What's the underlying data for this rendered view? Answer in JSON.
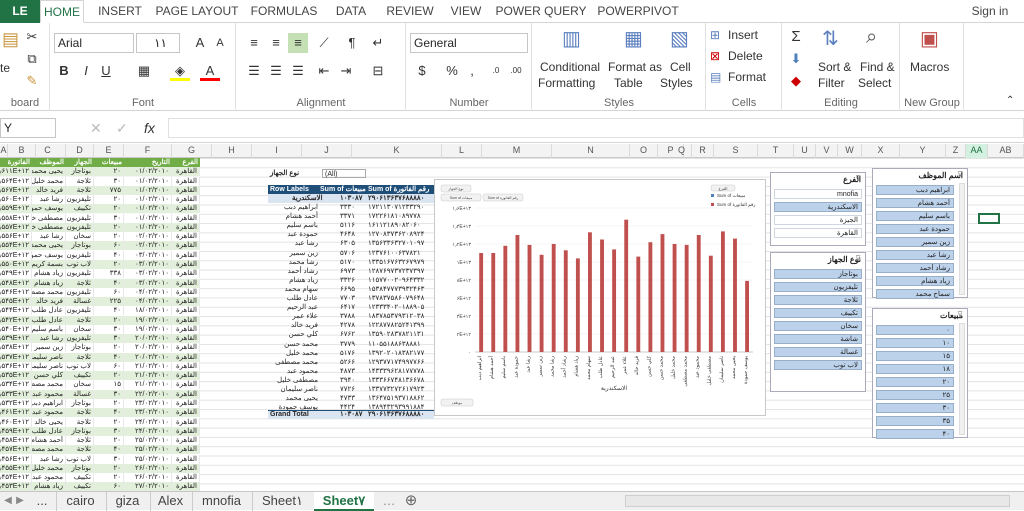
{
  "tabs": {
    "file": "LE",
    "items": [
      "HOME",
      "INSERT",
      "PAGE LAYOUT",
      "FORMULAS",
      "DATA",
      "REVIEW",
      "VIEW",
      "POWER QUERY",
      "POWERPIVOT"
    ],
    "signin": "Sign in"
  },
  "ribbon": {
    "clipboard": {
      "paste": "te",
      "label": "board"
    },
    "font": {
      "name": "Arial",
      "size": "۱۱",
      "grow": "A",
      "shrink": "A",
      "bold": "B",
      "italic": "I",
      "underline": "U",
      "label": "Font"
    },
    "alignment": {
      "label": "Alignment"
    },
    "number": {
      "format": "General",
      "pct": "%",
      "comma": ",",
      "label": "Number"
    },
    "styles": {
      "cond1": "Conditional",
      "cond2": "Formatting",
      "table1": "Format as",
      "table2": "Table",
      "cell1": "Cell",
      "cell2": "Styles",
      "label": "Styles"
    },
    "cells": {
      "insert": "Insert",
      "delete": "Delete",
      "format": "Format",
      "label": "Cells"
    },
    "editing": {
      "sort1": "Sort &",
      "sort2": "Filter",
      "find1": "Find &",
      "find2": "Select",
      "label": "Editing"
    },
    "newgroup": {
      "macros": "Macros",
      "label": "New Group"
    }
  },
  "namebox": "Y",
  "columns": [
    "A",
    "B",
    "C",
    "D",
    "E",
    "F",
    "G",
    "H",
    "I",
    "J",
    "K",
    "L",
    "M",
    "N",
    "O",
    "P",
    "Q",
    "R",
    "S",
    "T",
    "U",
    "V",
    "W",
    "X",
    "Y",
    "Z",
    "AA",
    "AB"
  ],
  "table": {
    "headers": [
      "الفاتورة",
      "الموظف",
      "الجهاز",
      "مبيعات",
      "التاريخ",
      "الفرع"
    ],
    "rows": [
      [
        "۲٫۶۱۱E+۱۲",
        "يحيى محمد",
        "بوتاجاز",
        "۲۰",
        "۰۱/۰۲/۲۰۱۰",
        "القاهرة"
      ],
      [
        "۲٫۵۶۴E+۱۲",
        "محمد خليل",
        "ثلاجة",
        "۳۰",
        "۰۱/۰۲/۲۰۱۰",
        "القاهرة"
      ],
      [
        "۲٫۵۶۷E+۱۲",
        "فريد خالد",
        "ثلاجة",
        "۷۷۵",
        "۰۱/۰۲/۲۰۱۰",
        "القاهرة"
      ],
      [
        "۲٫۵۶۰E+۱۲",
        "رشا عبد",
        "تليفزيون",
        "۲۰",
        "۰۱/۰۲/۲۰۱۰",
        "القاهرة"
      ],
      [
        "۲٫۵۵۹E+۱۲",
        "يوسف حمودة",
        "تكييف",
        "۲۰",
        "۰۱/۰۲/۲۰۱۰",
        "القاهرة"
      ],
      [
        "۲٫۵۵۸E+۱۲",
        "مصطفى خليل",
        "تليفزيون",
        "۳۰",
        "۰۱/۰۲/۲۰۱۰",
        "القاهرة"
      ],
      [
        "۲٫۵۵۷E+۱۲",
        "مصطفى خليل",
        "تليفزيون",
        "۲۰",
        "۰۱/۰۲/۲۰۱۰",
        "القاهرة"
      ],
      [
        "۲٫۵۵۶E+۱۲",
        "رشا عبد",
        "سخان",
        "۲۰",
        "۰۲/۰۲/۲۰۱۰",
        "القاهرة"
      ],
      [
        "۲٫۵۵۴E+۱۲",
        "يحيى محمد",
        "بوتاجاز",
        "۶۰",
        "۰۲/۰۲/۲۰۱۰",
        "القاهرة"
      ],
      [
        "۲٫۵۵۲E+۱۲",
        "يوسف حمودة",
        "تليفزيون",
        "۴۰",
        "۰۳/۰۲/۲۰۱۰",
        "القاهرة"
      ],
      [
        "۲٫۵۵۰E+۱۲",
        "بسمة كريم",
        "لاب توب",
        "۲۰",
        "۰۳/۰۲/۲۰۱۰",
        "القاهرة"
      ],
      [
        "۲٫۵۴۹E+۱۲",
        "زياد هشام",
        "تليفزيون",
        "۳۳۸",
        "۰۳/۰۲/۲۰۱۰",
        "القاهرة"
      ],
      [
        "۲٫۵۴۸E+۱۲",
        "زياد هشام",
        "ثلاجة",
        "۴۰",
        "۰۳/۰۲/۲۰۱۰",
        "القاهرة"
      ],
      [
        "۲٫۵۴۶E+۱۲",
        "محمد مصطفى",
        "تليفزيون",
        "۶۰",
        "۰۴/۰۲/۲۰۱۰",
        "القاهرة"
      ],
      [
        "۲٫۵۴۵E+۱۲",
        "فريد خالد",
        "غسالة",
        "۲۲۵",
        "۰۴/۰۲/۲۰۱۰",
        "القاهرة"
      ],
      [
        "۲٫۵۴۴E+۱۲",
        "عادل طلب",
        "تليفزيون",
        "۴۰",
        "۱۸/۰۲/۲۰۱۰",
        "القاهرة"
      ],
      [
        "۲٫۵۴۲E+۱۲",
        "عادل طلب",
        "ثلاجة",
        "۲۰",
        "۱۹/۰۲/۲۰۱۰",
        "القاهرة"
      ],
      [
        "۲٫۵۴۰E+۱۲",
        "باسم سليم",
        "سخان",
        "۳۰",
        "۱۹/۰۲/۲۰۱۰",
        "القاهرة"
      ],
      [
        "۲٫۵۳۹E+۱۲",
        "رشا عبد",
        "تليفزيون",
        "۳۰",
        "۲۰/۰۲/۲۰۱۰",
        "القاهرة"
      ],
      [
        "۲٫۵۳۸E+۱۲",
        "زين سمير",
        "بوتاجاز",
        "۲۰",
        "۲۰/۰۲/۲۰۱۰",
        "القاهرة"
      ],
      [
        "۲٫۵۳۷E+۱۲",
        "ناصر سليمان",
        "ثلاجة",
        "۴۰",
        "۲۰/۰۲/۲۰۱۰",
        "القاهرة"
      ],
      [
        "۲٫۵۳۶E+۱۲",
        "ناصر سليمان",
        "لاب توب",
        "۶۰",
        "۲۱/۰۲/۲۰۱۰",
        "القاهرة"
      ],
      [
        "۲٫۵۳۵E+۱۲",
        "كلي حسن",
        "تكييف",
        "۲۰",
        "۲۱/۰۲/۲۰۱۰",
        "القاهرة"
      ],
      [
        "۲٫۵۳۴E+۱۲",
        "محمد مصطفى",
        "سخان",
        "۱۵",
        "۲۱/۰۲/۲۰۱۰",
        "القاهرة"
      ],
      [
        "۲٫۵۳۳E+۱۲",
        "محمود عبد",
        "غسالة",
        "۳۰",
        "۲۲/۰۲/۲۰۱۰",
        "القاهرة"
      ],
      [
        "۲٫۵۳۲E+۱۲",
        "ابراهيم دبب",
        "بوتاجاز",
        "۲۰",
        "۲۳/۰۲/۲۰۱۰",
        "القاهرة"
      ],
      [
        "۲٫۴۶۱E+۱۲",
        "محمود عبد",
        "ثلاجة",
        "۴۰",
        "۲۳/۰۲/۲۰۱۰",
        "القاهرة"
      ],
      [
        "۲٫۴۶۰E+۱۲",
        "يحيى خالد",
        "ثلاجة",
        "۲۰",
        "۲۴/۰۲/۲۰۱۰",
        "القاهرة"
      ],
      [
        "۲٫۴۵۹E+۱۲",
        "عادل طلب",
        "بوتاجاز",
        "۳۰",
        "۲۴/۰۲/۲۰۱۰",
        "القاهرة"
      ],
      [
        "۲٫۴۵۸E+۱۲",
        "أحمد هشام",
        "ثلاجة",
        "۲۰",
        "۲۵/۰۲/۲۰۱۰",
        "القاهرة"
      ],
      [
        "۲٫۴۵۷E+۱۲",
        "محمد مصطفى",
        "ثلاجة",
        "۴۰",
        "۲۵/۰۲/۲۰۱۰",
        "القاهرة"
      ],
      [
        "۲٫۴۵۶E+۱۲",
        "رشا عبد",
        "لاب توب",
        "۳۰",
        "۲۵/۰۲/۲۰۱۰",
        "القاهرة"
      ],
      [
        "۲٫۴۵۵E+۱۲",
        "محمد خليل",
        "بوتاجاز",
        "۲۰",
        "۲۶/۰۲/۲۰۱۰",
        "القاهرة"
      ],
      [
        "۲٫۴۵۴E+۱۲",
        "محمود عبد",
        "تكييف",
        "۲۰",
        "۲۶/۰۲/۲۰۱۰",
        "القاهرة"
      ],
      [
        "۲٫۴۵۳E+۱۲",
        "زياد هشام",
        "تكييف",
        "۶۰",
        "۲۷/۰۲/۲۰۱۰",
        "القاهرة"
      ]
    ]
  },
  "pivot": {
    "filter_label": "نوع الجهاز",
    "filter_value": "(All)",
    "headers": [
      "Row Labels",
      "Sum of مبيعات",
      "Sum of رقم الفاتورة"
    ],
    "group": "الاسكندرية",
    "group_vals": [
      "۱۰۳۰۸۷",
      "۲۹۰۶۱۳۶۳۷۶۸۸۸۸۰"
    ],
    "rows": [
      [
        "ابراهيم دبب",
        "۳۳۳۰",
        "۱۷۲۱۱۳۰۷۱۲۳۳۲۹۰"
      ],
      [
        "أحمد هشام",
        "۳۳۷۱",
        "۱۷۲۲۶۱۸۱۰۸۹۷۷۸"
      ],
      [
        "باسم سليم",
        "۵۱۱۶",
        "۱۶۱۱۲۱۸۹۰۸۲۰۶۰"
      ],
      [
        "حمودة عبد",
        "۴۶۴۸",
        "۱۲۷۰۸۳۷۳۶۲۰۸۹۲۴"
      ],
      [
        "رشا عبد",
        "۶۳۰۵",
        "۱۳۵۶۳۳۶۳۲۷۰۱۰۹۷"
      ],
      [
        "زين سمير",
        "۵۷۰۶",
        "۱۲۳۷۶۱۰۰۶۳۷۸۲۱"
      ],
      [
        "رشا محمد",
        "۵۱۷۰",
        "۱۳۳۵۱۶۷۶۳۲۶۷۹۷۹"
      ],
      [
        "رشاد أحمد",
        "۶۹۷۳",
        "۱۲۸۷۶۹۷۳۷۲۳۷۳۹۷"
      ],
      [
        "زياد هشام",
        "۳۳۲۶",
        "۱۱۵۷۷۰۰۲۰۹۶۴۳۳۲"
      ],
      [
        "سهام محمد",
        "۶۶۹۵",
        "۱۵۳۸۴۷۷۷۳۹۳۲۴۶۳"
      ],
      [
        "عادل طلب",
        "۷۷۰۳",
        "۱۳۷۸۳۷۵۸۶۰۷۹۶۴۸"
      ],
      [
        "عبد الرحيم",
        "۶۴۱۷",
        "۱۲۳۳۳۴۰۲۰۱۸۸۹۰۵"
      ],
      [
        "علاء عمر",
        "۳۷۸۸",
        "۱۸۳۷۸۵۳۷۹۳۱۲۰۳۸"
      ],
      [
        "فريد خالد",
        "۴۲۷۸",
        "۱۲۲۸۷۷۸۲۵۲۴۱۳۹۹"
      ],
      [
        "كلي حسن",
        "۶۷۶۲",
        "۱۳۵۹۰۲۸۳۷۸۲۱۱۳۱"
      ],
      [
        "محمد حسن",
        "۳۷۷۹",
        "۱۱۰۵۵۱۸۸۶۳۸۸۸۱"
      ],
      [
        "محمد خليل",
        "۵۱۷۶",
        "۱۳۹۲۰۲۰۱۸۳۸۲۱۷۷"
      ],
      [
        "محمد مصطفى",
        "۵۲۶۶",
        "۱۲۹۳۷۷۱۷۴۹۹۷۷۶۶"
      ],
      [
        "محمود عبد",
        "۴۸۷۳",
        "۱۴۳۳۳۹۶۲۸۱۷۷۷۷۸"
      ],
      [
        "مصطفى خليل",
        "۳۹۴۰",
        "۱۳۳۳۶۶۷۴۸۱۳۶۶۷۸"
      ],
      [
        "ناصر سليمان",
        "۷۷۲۶",
        "۱۳۳۷۷۳۲۷۲۶۱۷۹۲۳"
      ],
      [
        "يحيى محمد",
        "۴۷۳۳",
        "۱۳۶۴۷۵۱۹۳۷۱۸۸۶۲"
      ],
      [
        "يوسف حمودة",
        "۴۴۲۴",
        "۱۳۸۹۴۳۲۹۳۹۹۱۸۸۴"
      ]
    ],
    "total": "Grand Total",
    "total_vals": [
      "۱۰۳۰۸۷",
      "۲۹۰۶۱۳۶۳۷۶۸۸۸۸۰"
    ]
  },
  "chart_data": {
    "type": "bar",
    "categories": [
      "ابراهيم دبب",
      "أحمد هشام",
      "باسم سليم",
      "حمودة عبد",
      "رشا عبد",
      "زين سمير",
      "رشا محمد",
      "رشاد أحمد",
      "زياد هشام",
      "سهام محمد",
      "عادل طلب",
      "عبد الرحيم",
      "علاء عمر",
      "فريد خالد",
      "كلي حسن",
      "محمد حسن",
      "محمد خليل",
      "محمد مصطفى",
      "محمود عبد",
      "مصطفى خليل",
      "ناصر سليمان",
      "يحيى محمد",
      "يوسف حمودة"
    ],
    "series": [
      {
        "name": "Sum of مبيعات",
        "color": "#4f81bd",
        "values": [
          0,
          0,
          0,
          0,
          0,
          0,
          0,
          0,
          0,
          0,
          0,
          0,
          0,
          0,
          0,
          0,
          0,
          0,
          0,
          0,
          0,
          0,
          0
        ]
      },
      {
        "name": "Sum of رقم الفاتورة",
        "color": "#c0504d",
        "values": [
          11000000000000.0,
          11000000000000.0,
          11800000000000.0,
          13000000000000.0,
          11900000000000.0,
          10800000000000.0,
          12000000000000.0,
          11300000000000.0,
          10400000000000.0,
          13300000000000.0,
          12500000000000.0,
          11400000000000.0,
          14700000000000.0,
          10600000000000.0,
          12200000000000.0,
          13100000000000.0,
          12000000000000.0,
          11900000000000.0,
          13000000000000.0,
          10700000000000.0,
          13400000000000.0,
          12600000000000.0,
          7900000000000.0
        ]
      }
    ],
    "yticks": [
      "۱٫۶E+۱۳",
      "۱٫۴E+۱۳",
      "۱٫۲E+۱۳",
      "۱E+۱۳",
      "۸E+۱۲",
      "۶E+۱۲",
      "۴E+۱۲",
      "۲E+۱۲",
      "۰"
    ],
    "ylim": [
      0,
      16000000000000.0
    ],
    "xlabel": "الاسكندرية",
    "legend": [
      "Sum of مبيعات",
      "Sum of رقم الفاتورة"
    ],
    "filter_btns": [
      "نوع الجهاز",
      "Sum of مبيعات",
      "Sum of رقم الفاتورة",
      "موظف",
      "الفرع"
    ]
  },
  "slicers": {
    "branch": {
      "title": "الفرع",
      "items": [
        "mnofia",
        "الاسكندرية",
        "الجيزة",
        "القاهرة"
      ],
      "on": [
        false,
        true,
        false,
        false
      ]
    },
    "device": {
      "title": "نوع الجهاز",
      "items": [
        "بوتاجاز",
        "تليفزيون",
        "ثلاجة",
        "تكييف",
        "سخان",
        "شاشة",
        "غسالة",
        "لاب توب"
      ]
    },
    "employee": {
      "title": "اسم الموظف",
      "items": [
        "ابراهيم دبب",
        "أحمد هشام",
        "باسم سليم",
        "حمودة عبد",
        "زين سمير",
        "رشا عبد",
        "رشاد أحمد",
        "زياد هشام",
        "سماح محمد"
      ]
    },
    "sales": {
      "title": "مبيعات",
      "items": [
        "۰",
        "۱۰",
        "۱۵",
        "۱۸",
        "۲۰",
        "۲۵",
        "۳۰",
        "۳۵",
        "۴۰"
      ]
    }
  },
  "sheets": [
    "...",
    "cairo",
    "giza",
    "Alex",
    "mnofia",
    "Sheet۱",
    "Sheet۷"
  ],
  "active_sheet": "Sheet۷"
}
